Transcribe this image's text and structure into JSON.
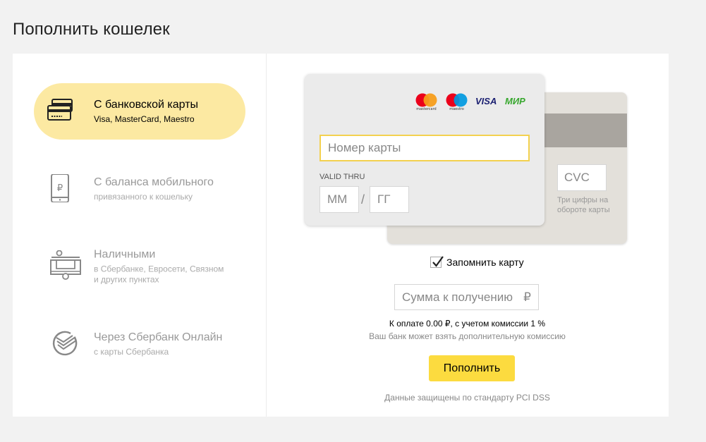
{
  "page": {
    "title": "Пополнить кошелек"
  },
  "methods": [
    {
      "title": "С банковской карты",
      "subtitle": "Visa, MasterCard, Maestro",
      "icon": "bank-card-icon",
      "active": true
    },
    {
      "title": "С баланса мобильного",
      "subtitle": "привязанного к кошельку",
      "icon": "mobile-ruble-icon",
      "active": false
    },
    {
      "title": "Наличными",
      "subtitle_lines": [
        "в Сбербанке, Евросети, Связном",
        "и других пунктах"
      ],
      "icon": "cash-terminal-icon",
      "active": false
    },
    {
      "title": "Через Сбербанк Онлайн",
      "subtitle": "с карты Сбербанка",
      "icon": "sberbank-icon",
      "active": false
    }
  ],
  "card": {
    "logos": {
      "mastercard": "mastercard",
      "maestro": "maestro",
      "visa": "VISA",
      "mir": "МИР"
    },
    "number_placeholder": "Номер карты",
    "valid_thru_label": "VALID THRU",
    "month_placeholder": "ММ",
    "year_placeholder": "ГГ",
    "slash": "/",
    "cvc_placeholder": "CVC",
    "cvc_hint": "Три цифры на обороте карты"
  },
  "remember": {
    "label": "Запомнить карту",
    "checked": true
  },
  "amount": {
    "placeholder": "Сумма к получению",
    "currency": "₽"
  },
  "payment": {
    "to_pay": "К оплате 0.00 ₽, с учетом комиссии 1 %",
    "bank_fee_note": "Ваш банк может взять дополнительную комиссию"
  },
  "button": {
    "label": "Пополнить"
  },
  "security_note": "Данные защищены по стандарту PCI DSS",
  "colors": {
    "accent": "#fcdb3f",
    "active_bg": "#fce9a2",
    "input_focus": "#f3d14f",
    "mir_green": "#37a72e",
    "visa_blue": "#1a1f71"
  }
}
